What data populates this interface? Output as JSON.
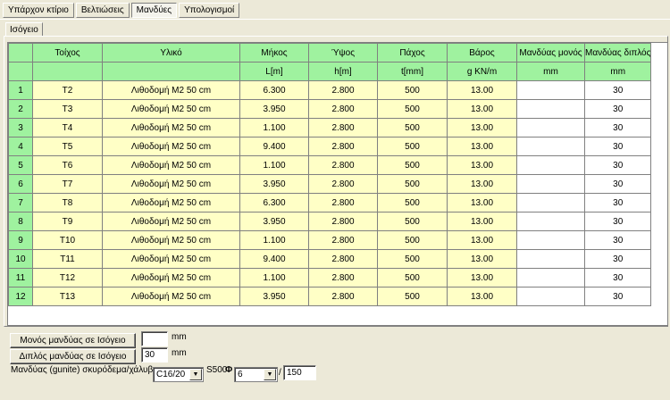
{
  "tabs": [
    {
      "label": "Υπάρχον κτίριο"
    },
    {
      "label": "Βελτιώσεις"
    },
    {
      "label": "Μανδύες"
    },
    {
      "label": "Υπολογισμοί"
    }
  ],
  "floor_tab": "Ισόγειο",
  "table": {
    "headers": [
      "Τοίχος",
      "Υλικό",
      "Μήκος",
      "Ύψος",
      "Πάχος",
      "Βάρος",
      "Μανδύας μονός",
      "Μανδύας διπλός"
    ],
    "units": [
      "",
      "",
      "L[m]",
      "h[m]",
      "t[mm]",
      "g KN/m",
      "mm",
      "mm"
    ],
    "rows": [
      {
        "n": "1",
        "wall": "T2",
        "material": "Λιθοδομή M2 50 cm",
        "length": "6.300",
        "height": "2.800",
        "thick": "500",
        "weight": "13.00",
        "single": "",
        "double": "30"
      },
      {
        "n": "2",
        "wall": "T3",
        "material": "Λιθοδομή M2 50 cm",
        "length": "3.950",
        "height": "2.800",
        "thick": "500",
        "weight": "13.00",
        "single": "",
        "double": "30"
      },
      {
        "n": "3",
        "wall": "T4",
        "material": "Λιθοδομή M2 50 cm",
        "length": "1.100",
        "height": "2.800",
        "thick": "500",
        "weight": "13.00",
        "single": "",
        "double": "30"
      },
      {
        "n": "4",
        "wall": "T5",
        "material": "Λιθοδομή M2 50 cm",
        "length": "9.400",
        "height": "2.800",
        "thick": "500",
        "weight": "13.00",
        "single": "",
        "double": "30"
      },
      {
        "n": "5",
        "wall": "T6",
        "material": "Λιθοδομή M2 50 cm",
        "length": "1.100",
        "height": "2.800",
        "thick": "500",
        "weight": "13.00",
        "single": "",
        "double": "30"
      },
      {
        "n": "6",
        "wall": "T7",
        "material": "Λιθοδομή M2 50 cm",
        "length": "3.950",
        "height": "2.800",
        "thick": "500",
        "weight": "13.00",
        "single": "",
        "double": "30"
      },
      {
        "n": "7",
        "wall": "T8",
        "material": "Λιθοδομή M2 50 cm",
        "length": "6.300",
        "height": "2.800",
        "thick": "500",
        "weight": "13.00",
        "single": "",
        "double": "30"
      },
      {
        "n": "8",
        "wall": "T9",
        "material": "Λιθοδομή M2 50 cm",
        "length": "3.950",
        "height": "2.800",
        "thick": "500",
        "weight": "13.00",
        "single": "",
        "double": "30"
      },
      {
        "n": "9",
        "wall": "T10",
        "material": "Λιθοδομή M2 50 cm",
        "length": "1.100",
        "height": "2.800",
        "thick": "500",
        "weight": "13.00",
        "single": "",
        "double": "30"
      },
      {
        "n": "10",
        "wall": "T11",
        "material": "Λιθοδομή M2 50 cm",
        "length": "9.400",
        "height": "2.800",
        "thick": "500",
        "weight": "13.00",
        "single": "",
        "double": "30"
      },
      {
        "n": "11",
        "wall": "T12",
        "material": "Λιθοδομή M2 50 cm",
        "length": "1.100",
        "height": "2.800",
        "thick": "500",
        "weight": "13.00",
        "single": "",
        "double": "30"
      },
      {
        "n": "12",
        "wall": "T13",
        "material": "Λιθοδομή M2 50 cm",
        "length": "3.950",
        "height": "2.800",
        "thick": "500",
        "weight": "13.00",
        "single": "",
        "double": "30"
      }
    ]
  },
  "controls": {
    "single_button": "Μονός μανδύας σε Ισόγειο",
    "single_value": "",
    "single_unit": "mm",
    "double_button": "Διπλός μανδύας σε Ισόγειο",
    "double_value": "30",
    "double_unit": "mm",
    "gunite_label": "Μανδύας (gunite) σκυρόδεμα/χάλυβας",
    "concrete_select": "C16/20",
    "steel_label": "S500",
    "phi_symbol": "Φ",
    "bar_select": "6",
    "slash": "/",
    "spacing_value": "150"
  },
  "colors": {
    "header": "#9ff29f",
    "cell_yellow": "#ffffc6",
    "background": "#ece9d8"
  }
}
